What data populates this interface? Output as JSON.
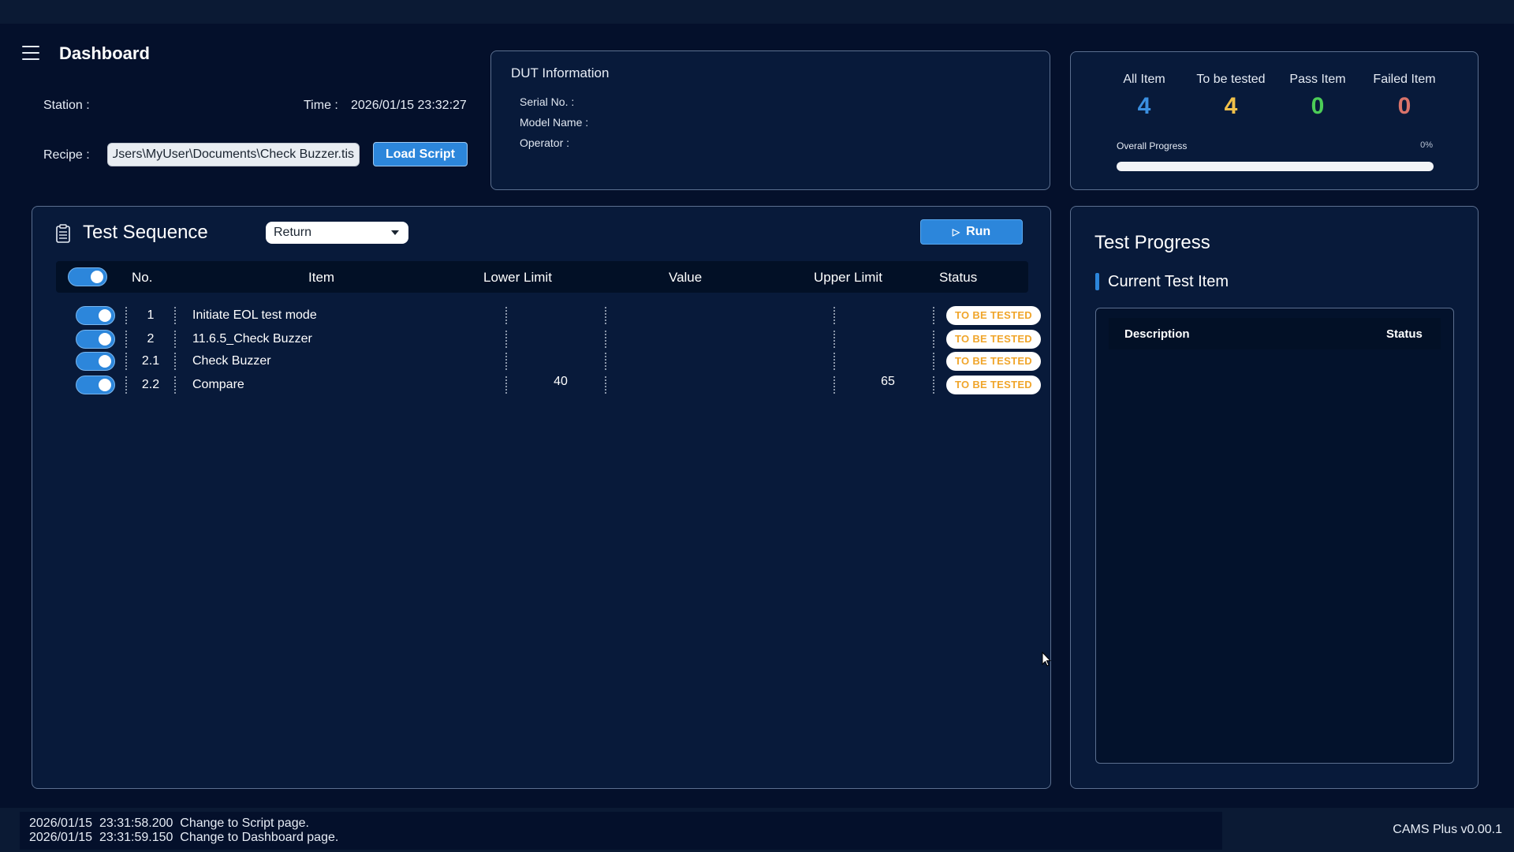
{
  "header": {
    "title": "Dashboard",
    "station_label": "Station :",
    "time_label": "Time :",
    "time_value": "2026/01/15 23:32:27",
    "recipe_label": "Recipe :",
    "recipe_value": "C:\\Users\\MyUser\\Documents\\Check Buzzer.tis",
    "load_button": "Load Script"
  },
  "dut": {
    "title": "DUT Information",
    "serial_label": "Serial No. :",
    "model_label": "Model Name :",
    "operator_label": "Operator :"
  },
  "stats": {
    "all_label": "All Item",
    "all_value": "4",
    "tbt_label": "To be tested",
    "tbt_value": "4",
    "pass_label": "Pass Item",
    "pass_value": "0",
    "fail_label": "Failed Item",
    "fail_value": "0",
    "progress_label": "Overall Progress",
    "progress_pct": "0%",
    "progress_fraction": 0
  },
  "sequence": {
    "title": "Test Sequence",
    "select_value": "Return",
    "run_button": "Run",
    "columns": {
      "no": "No.",
      "item": "Item",
      "lower": "Lower Limit",
      "value": "Value",
      "upper": "Upper Limit",
      "status": "Status"
    },
    "rows": [
      {
        "no": "1",
        "item": "Initiate EOL test mode",
        "lower": "",
        "value": "",
        "upper": "",
        "status": "TO BE TESTED"
      },
      {
        "no": "2",
        "item": "11.6.5_Check Buzzer",
        "lower": "",
        "value": "",
        "upper": "",
        "status": "TO BE TESTED"
      },
      {
        "no": "2.1",
        "item": "Check Buzzer",
        "lower": "",
        "value": "",
        "upper": "",
        "status": "TO BE TESTED"
      },
      {
        "no": "2.2",
        "item": "Compare",
        "lower": "40",
        "value": "",
        "upper": "65",
        "status": "TO BE TESTED"
      }
    ]
  },
  "progress": {
    "title": "Test Progress",
    "current_title": "Current Test Item",
    "col_description": "Description",
    "col_status": "Status"
  },
  "footer": {
    "logs": [
      "2026/01/15  23:31:58.200  Change to Script page.",
      "2026/01/15  23:31:59.150  Change to Dashboard page."
    ],
    "version": "CAMS Plus v0.00.1"
  },
  "colors": {
    "background": "#04102b",
    "accent": "#2c86db",
    "all": "#3a8fe0",
    "to_be_tested": "#f0c04a",
    "pass": "#4ccd57",
    "fail": "#d9736a",
    "status_text": "#f0a52a"
  }
}
